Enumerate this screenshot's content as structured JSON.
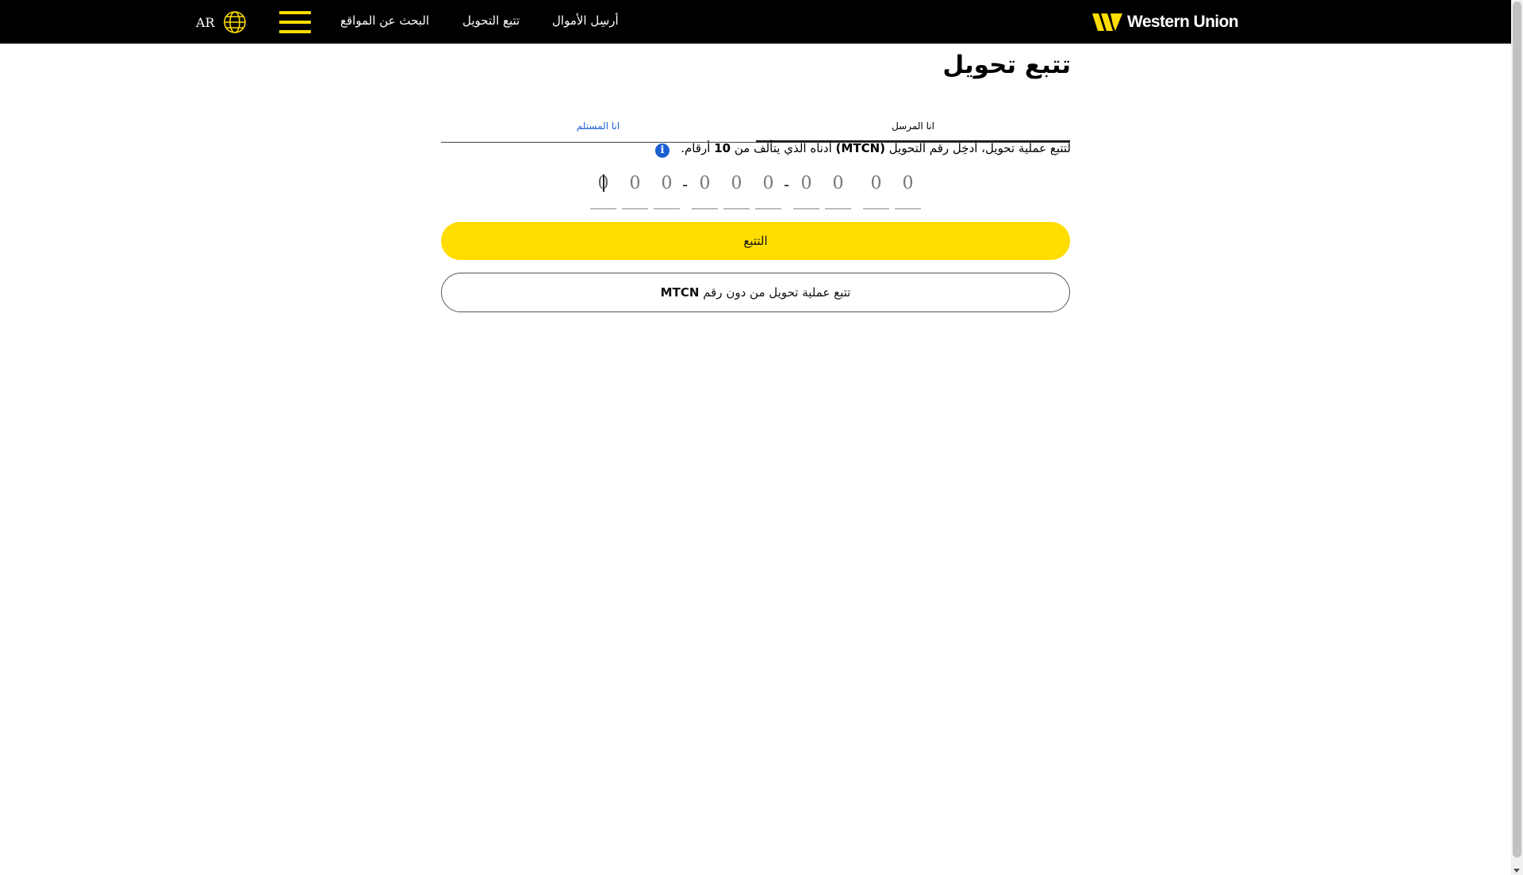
{
  "header": {
    "brand": "Western Union",
    "language": "AR",
    "nav": {
      "send_money": "أرسِل الأموال",
      "track_transfer": "تتبع التحويل",
      "find_locations": "البحث عن المواقع"
    }
  },
  "main": {
    "title": "تتبع تحويل",
    "tabs": {
      "receiver": "انا المستلم",
      "sender": "انا المرسل"
    },
    "instruction": {
      "part1": "لتتبع عملية تحويل، أدخِل رقم التحويل ",
      "code": "(MTCN)",
      "part2": " أدناه الذي يتألف من ",
      "count": "10",
      "part3": " أرقام."
    },
    "mtcn_digits": [
      "0",
      "0",
      "0",
      "0",
      "0",
      "0",
      "0",
      "0",
      "0",
      "0"
    ],
    "separator": "-",
    "track_button": "التتبع",
    "no_mtcn_button": {
      "text": "تتبع عملية تحويل من دون رقم",
      "code": "MTCN"
    }
  },
  "colors": {
    "header_bg": "#000000",
    "accent_yellow": "#ffdd00",
    "link_blue": "#1e5bd6",
    "info_blue": "#1c5fd1"
  }
}
